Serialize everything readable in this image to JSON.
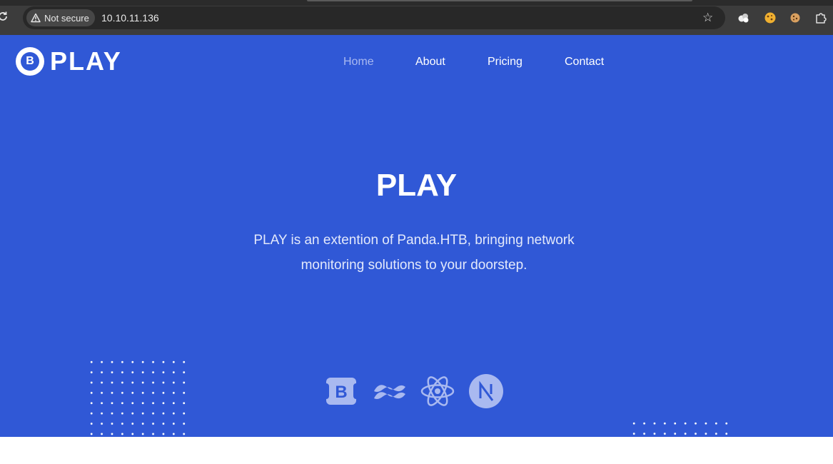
{
  "browser": {
    "security_label": "Not secure",
    "url": "10.10.11.136",
    "icons": [
      "reload-icon",
      "warning-icon",
      "star-icon",
      "extension-icons",
      "puzzle-icon"
    ]
  },
  "site": {
    "logo_letter": "B",
    "logo_text": "PLAY",
    "nav": [
      {
        "label": "Home",
        "active": true
      },
      {
        "label": "About"
      },
      {
        "label": "Pricing"
      },
      {
        "label": "Contact"
      }
    ],
    "hero": {
      "title": "PLAY",
      "description": "PLAY is an extention of Panda.HTB, bringing network monitoring solutions to your doorstep."
    },
    "tech_icons": [
      "bootstrap-icon",
      "tailwind-icon",
      "react-icon",
      "nextjs-icon"
    ],
    "colors": {
      "background": "#3058d6",
      "text": "#ffffff",
      "nav_active": "#a9b9f0"
    }
  }
}
